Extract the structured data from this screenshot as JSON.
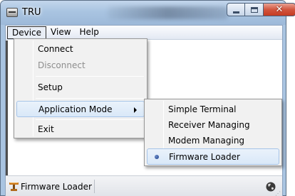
{
  "window": {
    "title": "TRU",
    "close_glyph": "✕"
  },
  "menubar": {
    "items": [
      "Device",
      "View",
      "Help"
    ]
  },
  "device_menu": {
    "items": [
      {
        "label": "Connect",
        "enabled": true
      },
      {
        "label": "Disconnect",
        "enabled": false
      },
      {
        "label": "Setup",
        "enabled": true
      },
      {
        "label": "Application Mode",
        "enabled": true,
        "has_submenu": true,
        "highlighted": true
      },
      {
        "label": "Exit",
        "enabled": true
      }
    ]
  },
  "application_mode_submenu": {
    "items": [
      {
        "label": "Simple Terminal",
        "selected": false
      },
      {
        "label": "Receiver Managing",
        "selected": false
      },
      {
        "label": "Modem Managing",
        "selected": false
      },
      {
        "label": "Firmware Loader",
        "selected": true
      }
    ]
  },
  "statusbar": {
    "mode_text": "Firmware Loader",
    "mode_icon": "antenna-icon",
    "connection_icon": "globe-icon"
  },
  "colors": {
    "selection_accent": "#1c3f8a",
    "highlight_border": "#a6c4e8",
    "close_button": "#c43b22"
  }
}
